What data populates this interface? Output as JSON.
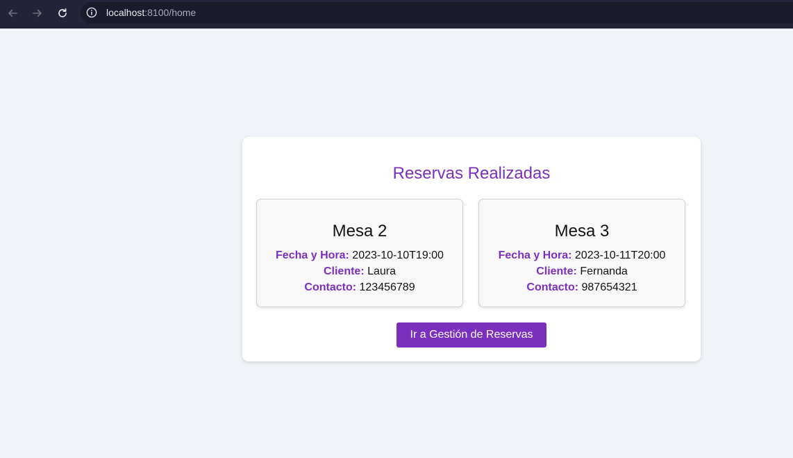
{
  "browser": {
    "url_host": "localhost",
    "url_rest": ":8100/home"
  },
  "panel": {
    "title": "Reservas Realizadas",
    "labels": {
      "fecha": "Fecha y Hora:",
      "cliente": "Cliente:",
      "contacto": "Contacto:"
    },
    "reservations": [
      {
        "mesa": "Mesa 2",
        "fecha": "2023-10-10T19:00",
        "cliente": "Laura",
        "contacto": "123456789"
      },
      {
        "mesa": "Mesa 3",
        "fecha": "2023-10-11T20:00",
        "cliente": "Fernanda",
        "contacto": "987654321"
      }
    ],
    "button_label": "Ir a Gestión de Reservas"
  },
  "colors": {
    "accent": "#7b2fbf",
    "page_background": "#f0f3f7",
    "browser_bar": "#23233a"
  },
  "icons": [
    "back-arrow-icon",
    "forward-arrow-icon",
    "reload-icon",
    "info-icon"
  ]
}
